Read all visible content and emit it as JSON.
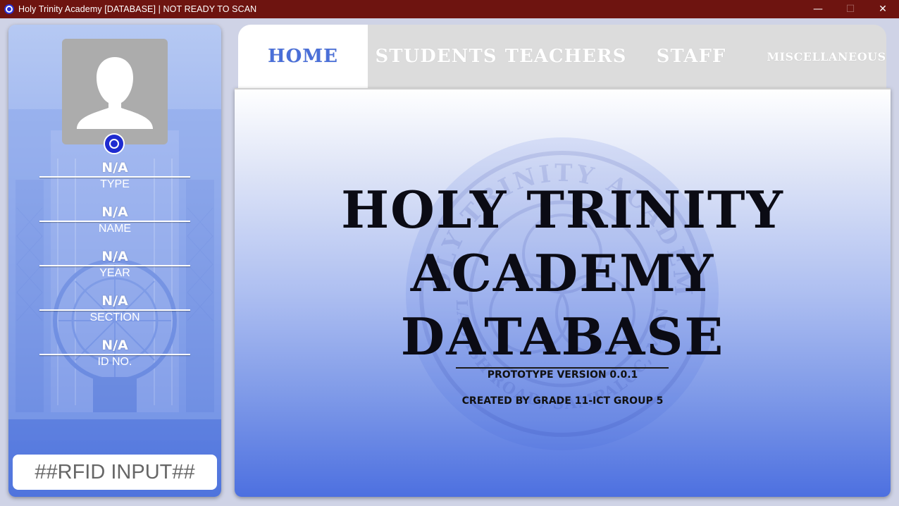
{
  "window": {
    "title": "Holy Trinity Academy [DATABASE] | NOT READY TO SCAN",
    "controls": {
      "minimize": "—",
      "maximize": "☐",
      "close": "✕"
    }
  },
  "profile": {
    "fields": [
      {
        "value": "N/A",
        "label": "TYPE"
      },
      {
        "value": "N/A",
        "label": "NAME"
      },
      {
        "value": "N/A",
        "label": "YEAR"
      },
      {
        "value": "N/A",
        "label": "SECTION"
      },
      {
        "value": "N/A",
        "label": "ID NO."
      }
    ],
    "rfid_placeholder": "##RFID INPUT##"
  },
  "tabs": [
    {
      "label": "HOME",
      "active": true
    },
    {
      "label": "STUDENTS",
      "active": false
    },
    {
      "label": "TEACHERS",
      "active": false
    },
    {
      "label": "STAFF",
      "active": false
    },
    {
      "label": "MISCELLANEOUS",
      "active": false
    }
  ],
  "home": {
    "title_lines": [
      "HOLY TRINITY",
      "ACADEMY",
      "DATABASE"
    ],
    "version": "PROTOTYPE VERSION 0.0.1",
    "credits": "CREATED BY GRADE 11-ICT GROUP 5",
    "watermark_text_top": "HOLY TRINITY ACADEMY",
    "watermark_text_bottom": "CALABASH ROAD, SAMPALOC, MANILA"
  },
  "colors": {
    "titlebar": "#6e1410",
    "accent": "#4a6fd8",
    "tab_inactive": "#dcdcdc"
  }
}
